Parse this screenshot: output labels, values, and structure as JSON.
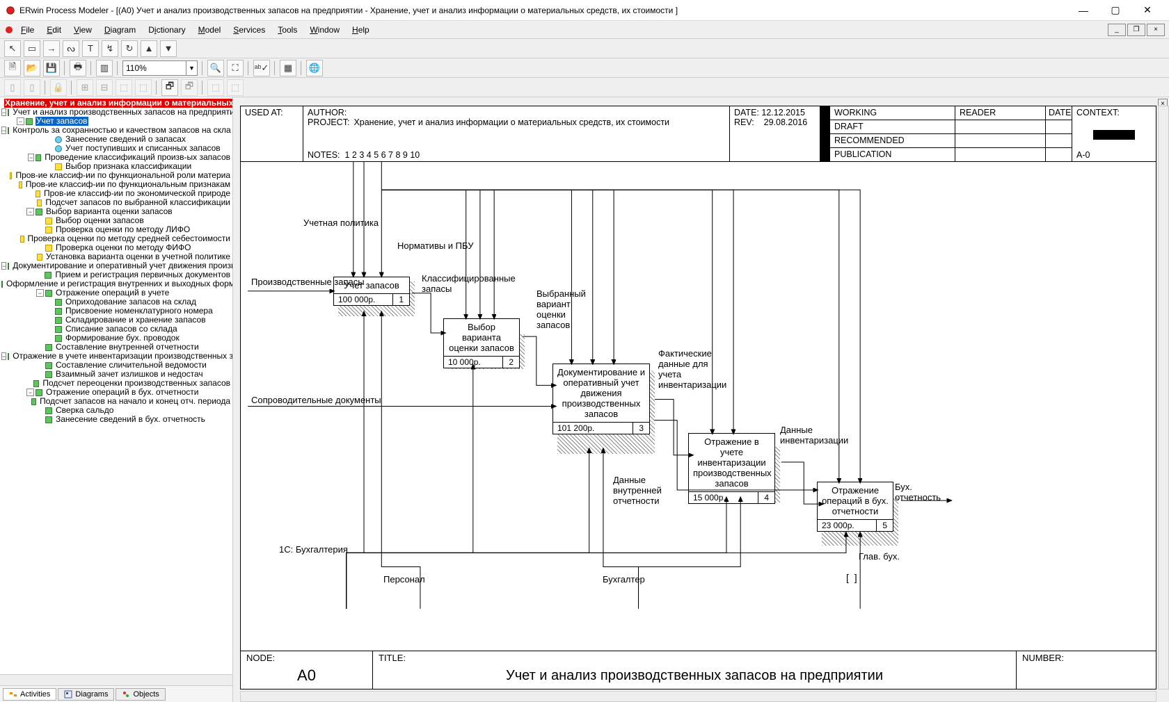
{
  "window": {
    "title": "ERwin Process Modeler - [(A0) Учет и анализ производственных запасов на предприятии - Хранение, учет и анализ информации о материальных средств, их стоимости ]"
  },
  "menus": [
    "File",
    "Edit",
    "View",
    "Diagram",
    "Dictionary",
    "Model",
    "Services",
    "Tools",
    "Window",
    "Help"
  ],
  "zoom": "110%",
  "tree": {
    "root": "Хранение, учет и анализ информации о материальных ср",
    "l1": "Учет и анализ производственных запасов на предприятии",
    "sel": "Учет запасов",
    "items": [
      {
        "d": 3,
        "t": "g",
        "e": "-",
        "lbl": "Контроль за  сохранностью и качеством запасов на скла"
      },
      {
        "d": 4,
        "t": "c",
        "e": "",
        "lbl": "Занесение сведений  о запасах"
      },
      {
        "d": 4,
        "t": "c",
        "e": "",
        "lbl": "Учет поступивших и списанных запасов"
      },
      {
        "d": 3,
        "t": "g",
        "e": "-",
        "lbl": "Проведение  классификаций произв-ых  запасов"
      },
      {
        "d": 4,
        "t": "y",
        "e": "",
        "lbl": "Выбор признака классификации"
      },
      {
        "d": 4,
        "t": "y",
        "e": "",
        "lbl": "Пров-ие классиф-ии по  функциональной роли материа"
      },
      {
        "d": 4,
        "t": "y",
        "e": "",
        "lbl": "Пров-ие классиф-ии по функциональным  признакам"
      },
      {
        "d": 4,
        "t": "y",
        "e": "",
        "lbl": "Пров-ие  классиф-ии по  экономической природе"
      },
      {
        "d": 4,
        "t": "y",
        "e": "",
        "lbl": "Подсчет запасов по выбранной классификации"
      },
      {
        "d": 2,
        "t": "g",
        "e": "-",
        "lbl": "Выбор варианта  оценки запасов"
      },
      {
        "d": 3,
        "t": "y",
        "e": "",
        "lbl": "Выбор оценки  запасов"
      },
      {
        "d": 3,
        "t": "y",
        "e": "",
        "lbl": "Проверка оценки  по методу ЛИФО"
      },
      {
        "d": 3,
        "t": "y",
        "e": "",
        "lbl": "Проверка оценки по методу средней себестоимости"
      },
      {
        "d": 3,
        "t": "y",
        "e": "",
        "lbl": "Проверка оценки  по методу ФИФО"
      },
      {
        "d": 3,
        "t": "y",
        "e": "",
        "lbl": "Установка варианта оценки в учетной политике"
      },
      {
        "d": 2,
        "t": "g",
        "e": "-",
        "lbl": "Документирование  и оперативный учет  движения производс"
      },
      {
        "d": 3,
        "t": "g",
        "e": "",
        "lbl": "Прием и регистрация первичных документов"
      },
      {
        "d": 3,
        "t": "g",
        "e": "",
        "lbl": "Оформление и регистрация  внутренних и выходных форм"
      },
      {
        "d": 3,
        "t": "g",
        "e": "-",
        "lbl": "Отражение операций в учете"
      },
      {
        "d": 4,
        "t": "g",
        "e": "",
        "lbl": "Оприходование  запасов на склад"
      },
      {
        "d": 4,
        "t": "g",
        "e": "",
        "lbl": "Присвоение номенклатурного номера"
      },
      {
        "d": 4,
        "t": "g",
        "e": "",
        "lbl": "Складирование  и хранение запасов"
      },
      {
        "d": 4,
        "t": "g",
        "e": "",
        "lbl": "Списание запасов  со склада"
      },
      {
        "d": 4,
        "t": "g",
        "e": "",
        "lbl": "Формирование бух. проводок"
      },
      {
        "d": 3,
        "t": "g",
        "e": "",
        "lbl": "Составление  внутренней  отчетности"
      },
      {
        "d": 2,
        "t": "g",
        "e": "-",
        "lbl": "Отражение в учете  инвентаризации  производственных  зап"
      },
      {
        "d": 3,
        "t": "g",
        "e": "",
        "lbl": "Составление  сличительной  ведомости"
      },
      {
        "d": 3,
        "t": "g",
        "e": "",
        "lbl": "Взаимный зачет  излишков и  недостач"
      },
      {
        "d": 3,
        "t": "g",
        "e": "",
        "lbl": "Подсчет  переоценки  производственных  запасов"
      },
      {
        "d": 2,
        "t": "g",
        "e": "-",
        "lbl": "Отражение  операций в  бух. отчетности"
      },
      {
        "d": 3,
        "t": "g",
        "e": "",
        "lbl": "Подсчет запасов  на начало и конец  отч. периода"
      },
      {
        "d": 3,
        "t": "g",
        "e": "",
        "lbl": "Сверка сальдо"
      },
      {
        "d": 3,
        "t": "g",
        "e": "",
        "lbl": "Занесение сведений  в бух. отчетность"
      }
    ]
  },
  "tabs": [
    "Activities",
    "Diagrams",
    "Objects"
  ],
  "header": {
    "used_at": "USED AT:",
    "author": "AUTHOR:",
    "project_lbl": "PROJECT:",
    "project": "Хранение, учет и анализ информации о материальных средств, их стоимости",
    "notes_lbl": "NOTES:",
    "notes": "1  2  3  4  5  6  7  8  9  10",
    "date_lbl": "DATE:",
    "date": "12.12.2015",
    "rev_lbl": "REV:",
    "rev": "29.08.2016",
    "statuses": [
      "WORKING",
      "DRAFT",
      "RECOMMENDED",
      "PUBLICATION"
    ],
    "reader": "READER",
    "hdate": "DATE",
    "context": "CONTEXT:",
    "context_val": "A-0"
  },
  "footer": {
    "node_lbl": "NODE:",
    "node": "A0",
    "title_lbl": "TITLE:",
    "title": "Учет и анализ производственных запасов на предприятии",
    "number_lbl": "NUMBER:"
  },
  "boxes": {
    "b1": {
      "title": "Учет запасов",
      "cost": "100 000р.",
      "num": "1"
    },
    "b2": {
      "title": "Выбор варианта оценки запасов",
      "cost": "10 000р.",
      "num": "2"
    },
    "b3": {
      "title": "Документирование и оперативный учет движения производственных запасов",
      "cost": "101 200р.",
      "num": "3"
    },
    "b4": {
      "title": "Отражение в учете инвентаризации производственных запасов",
      "cost": "15 000р.",
      "num": "4"
    },
    "b5": {
      "title": "Отражение операций в бух. отчетности",
      "cost": "23 000р.",
      "num": "5"
    }
  },
  "labels": {
    "uchet_pol": "Учетная политика",
    "normativy": "Нормативы и ПБУ",
    "proizv_zap": "Производственные запасы",
    "klass_zap": "Классифицированные запасы",
    "vybr_var": "Выбранный вариант оценки запасов",
    "soprov": "Сопроводительные документы",
    "fakt_dannye": "Фактические данные для учета инвентаризации",
    "dannye_inv": "Данные инвентаризации",
    "dannye_otch": "Данные внутренней отчетности",
    "bux_otch": "Бух. отчетность",
    "c1s": "1С: Бухгалтерия",
    "personal": "Персонал",
    "buhgalter": "Бухгалтер",
    "glav_buh": "Глав. бух."
  },
  "chart_data": {
    "type": "IDEF0",
    "node": "A0",
    "title": "Учет и анализ производственных запасов на предприятии",
    "activities": [
      {
        "num": 1,
        "name": "Учет запасов",
        "cost_rub": 100000
      },
      {
        "num": 2,
        "name": "Выбор варианта оценки запасов",
        "cost_rub": 10000
      },
      {
        "num": 3,
        "name": "Документирование и оперативный учет движения производственных запасов",
        "cost_rub": 101200
      },
      {
        "num": 4,
        "name": "Отражение в учете инвентаризации производственных запасов",
        "cost_rub": 15000
      },
      {
        "num": 5,
        "name": "Отражение операций в бух. отчетности",
        "cost_rub": 23000
      }
    ],
    "inputs": [
      "Производственные запасы",
      "Сопроводительные документы"
    ],
    "controls": [
      "Учетная политика",
      "Нормативы и ПБУ"
    ],
    "mechanisms": [
      "1С: Бухгалтерия",
      "Персонал",
      "Бухгалтер",
      "Глав. бух."
    ],
    "outputs": [
      "Бух. отчетность"
    ],
    "internal_flows": [
      "Классифицированные запасы",
      "Выбранный вариант оценки запасов",
      "Фактические данные для учета инвентаризации",
      "Данные внутренней отчетности",
      "Данные инвентаризации"
    ]
  }
}
